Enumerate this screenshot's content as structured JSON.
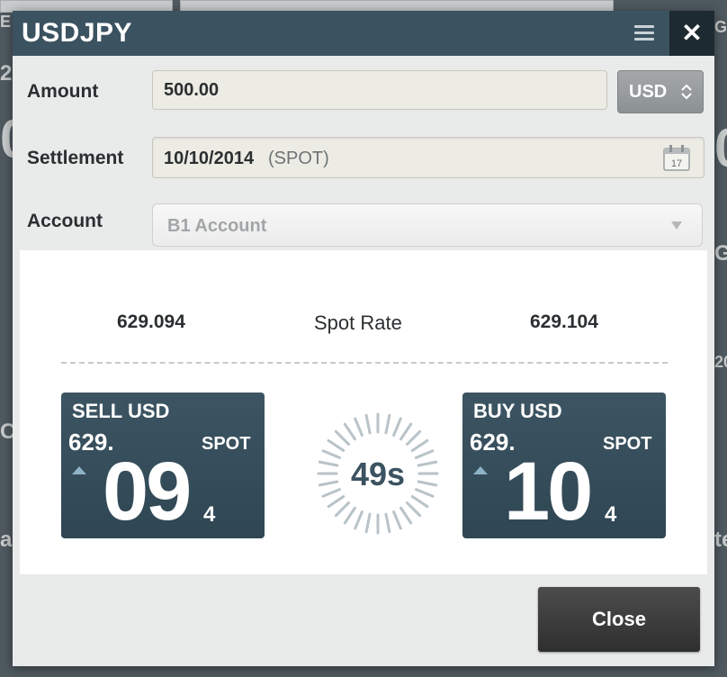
{
  "dialog": {
    "title": "USDJPY",
    "close_icon_glyph": "✕"
  },
  "background": {
    "left_letters": [
      "E",
      "2",
      "0",
      "C",
      "a"
    ],
    "right_letters": [
      "G",
      "0",
      "G",
      "20",
      "te"
    ]
  },
  "form": {
    "amount_label": "Amount",
    "amount_value": "500.00",
    "currency": "USD",
    "settlement_label": "Settlement",
    "settlement_date": "10/10/2014",
    "settlement_tenor": "(SPOT)",
    "calendar_day": "17",
    "account_label": "Account",
    "account_value": "B1 Account"
  },
  "quote": {
    "bid": "629.094",
    "label": "Spot Rate",
    "ask": "629.104",
    "sell": {
      "title": "SELL USD",
      "big_figure": "629.",
      "tenor": "SPOT",
      "pips": "09",
      "fraction": "4"
    },
    "buy": {
      "title": "BUY USD",
      "big_figure": "629.",
      "tenor": "SPOT",
      "pips": "10",
      "fraction": "4"
    },
    "timer": "49s"
  },
  "footer": {
    "close_label": "Close"
  },
  "colors": {
    "header": "#3b5260",
    "tile": "#33495a",
    "accent": "#8fb3c6"
  }
}
